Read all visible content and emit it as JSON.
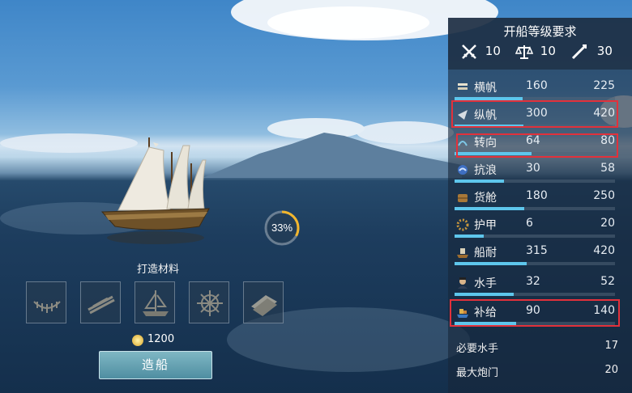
{
  "progress": {
    "value_label": "33%",
    "fraction": 0.33
  },
  "materials": {
    "title": "打造材料",
    "slots": [
      "hull-frame-icon",
      "planks-icon",
      "ship-icon",
      "helm-wheel-icon",
      "cloth-icon"
    ],
    "cost": "1200"
  },
  "build_button": "造船",
  "requirements": {
    "title": "开船等级要求",
    "combat": "10",
    "trade": "10",
    "explore": "30"
  },
  "stats": [
    {
      "name": "横帆",
      "current": "160",
      "max": "225",
      "icon": "square-sail-icon"
    },
    {
      "name": "纵帆",
      "current": "300",
      "max": "420",
      "icon": "lateen-sail-icon"
    },
    {
      "name": "转向",
      "current": "64",
      "max": "80",
      "icon": "rudder-icon"
    },
    {
      "name": "抗浪",
      "current": "30",
      "max": "58",
      "icon": "wave-icon"
    },
    {
      "name": "货舱",
      "current": "180",
      "max": "250",
      "icon": "cargo-icon"
    },
    {
      "name": "护甲",
      "current": "6",
      "max": "20",
      "icon": "armor-icon"
    },
    {
      "name": "船耐",
      "current": "315",
      "max": "420",
      "icon": "durability-icon"
    },
    {
      "name": "水手",
      "current": "32",
      "max": "52",
      "icon": "sailor-icon"
    },
    {
      "name": "补给",
      "current": "90",
      "max": "140",
      "icon": "supply-icon"
    }
  ],
  "footer": {
    "required_sailors_label": "必要水手",
    "required_sailors": "17",
    "max_gunports_label": "最大炮门",
    "max_gunports": "20"
  },
  "colors": {
    "bar": "#5ec6ec",
    "highlight": "#e2313b",
    "button": "#5f9fb0"
  }
}
